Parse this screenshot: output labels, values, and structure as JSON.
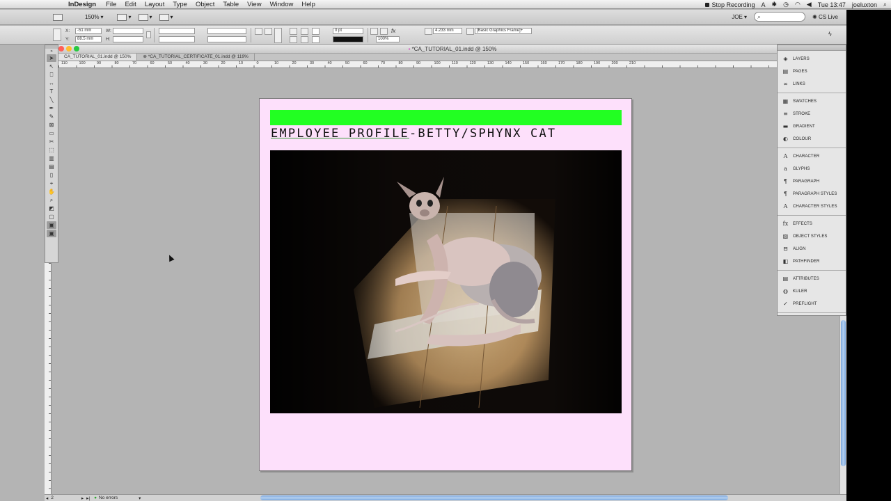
{
  "menubar": {
    "app_name": "InDesign",
    "menus": [
      "File",
      "Edit",
      "Layout",
      "Type",
      "Object",
      "Table",
      "View",
      "Window",
      "Help"
    ],
    "stop_recording": "Stop Recording",
    "clock": "Tue 13:47",
    "user": "joeluxton"
  },
  "appbar": {
    "zoom": "150%",
    "workspace": "JOE",
    "cs_live": "CS Live"
  },
  "control": {
    "x_label": "X:",
    "x_value": "-51 mm",
    "y_label": "Y:",
    "y_value": "88.5 mm",
    "w_label": "W:",
    "h_label": "H:",
    "stroke_weight": "0 pt",
    "opacity": "100%",
    "gap_value": "4.233 mm",
    "object_style": "[Basic Graphics Frame]+"
  },
  "window": {
    "title": "*CA_TUTORIAL_01.indd @ 150%",
    "tabs": [
      "CA_TUTORIAL_01.indd @ 150%",
      "*CA_TUTORIAL_CERTIFICATE_01.indd @ 119%"
    ]
  },
  "ruler": {
    "labels": [
      "110",
      "100",
      "90",
      "80",
      "70",
      "60",
      "50",
      "40",
      "30",
      "20",
      "10",
      "0",
      "10",
      "20",
      "30",
      "40",
      "50",
      "60",
      "70",
      "80",
      "90",
      "100",
      "110",
      "120",
      "130",
      "140",
      "150",
      "160",
      "170",
      "180",
      "190",
      "200",
      "210"
    ]
  },
  "document": {
    "headline_part1": "EMPLOYEE PROFILE",
    "headline_part2": "-BETTY/SPHYNX CAT",
    "green_bar_color": "#22ff22",
    "page_color": "#fde0fb"
  },
  "panels": {
    "groups": [
      [
        {
          "label": "LAYERS",
          "icon": "layers-icon"
        },
        {
          "label": "PAGES",
          "icon": "pages-icon"
        },
        {
          "label": "LINKS",
          "icon": "links-icon"
        }
      ],
      [
        {
          "label": "SWATCHES",
          "icon": "swatches-icon"
        },
        {
          "label": "STROKE",
          "icon": "stroke-icon"
        },
        {
          "label": "GRADIENT",
          "icon": "gradient-icon"
        },
        {
          "label": "COLOUR",
          "icon": "colour-icon"
        }
      ],
      [
        {
          "label": "CHARACTER",
          "icon": "character-icon"
        },
        {
          "label": "GLYPHS",
          "icon": "glyphs-icon"
        },
        {
          "label": "PARAGRAPH",
          "icon": "paragraph-icon"
        },
        {
          "label": "PARAGRAPH STYLES",
          "icon": "paragraph-styles-icon"
        },
        {
          "label": "CHARACTER STYLES",
          "icon": "character-styles-icon"
        }
      ],
      [
        {
          "label": "EFFECTS",
          "icon": "effects-icon"
        },
        {
          "label": "OBJECT STYLES",
          "icon": "object-styles-icon"
        },
        {
          "label": "ALIGN",
          "icon": "align-icon"
        },
        {
          "label": "PATHFINDER",
          "icon": "pathfinder-icon"
        }
      ],
      [
        {
          "label": "ATTRIBUTES",
          "icon": "attributes-icon"
        },
        {
          "label": "KULER",
          "icon": "kuler-icon"
        },
        {
          "label": "PREFLIGHT",
          "icon": "preflight-icon"
        }
      ]
    ]
  },
  "status": {
    "page_number": "2",
    "preflight": "No errors"
  }
}
